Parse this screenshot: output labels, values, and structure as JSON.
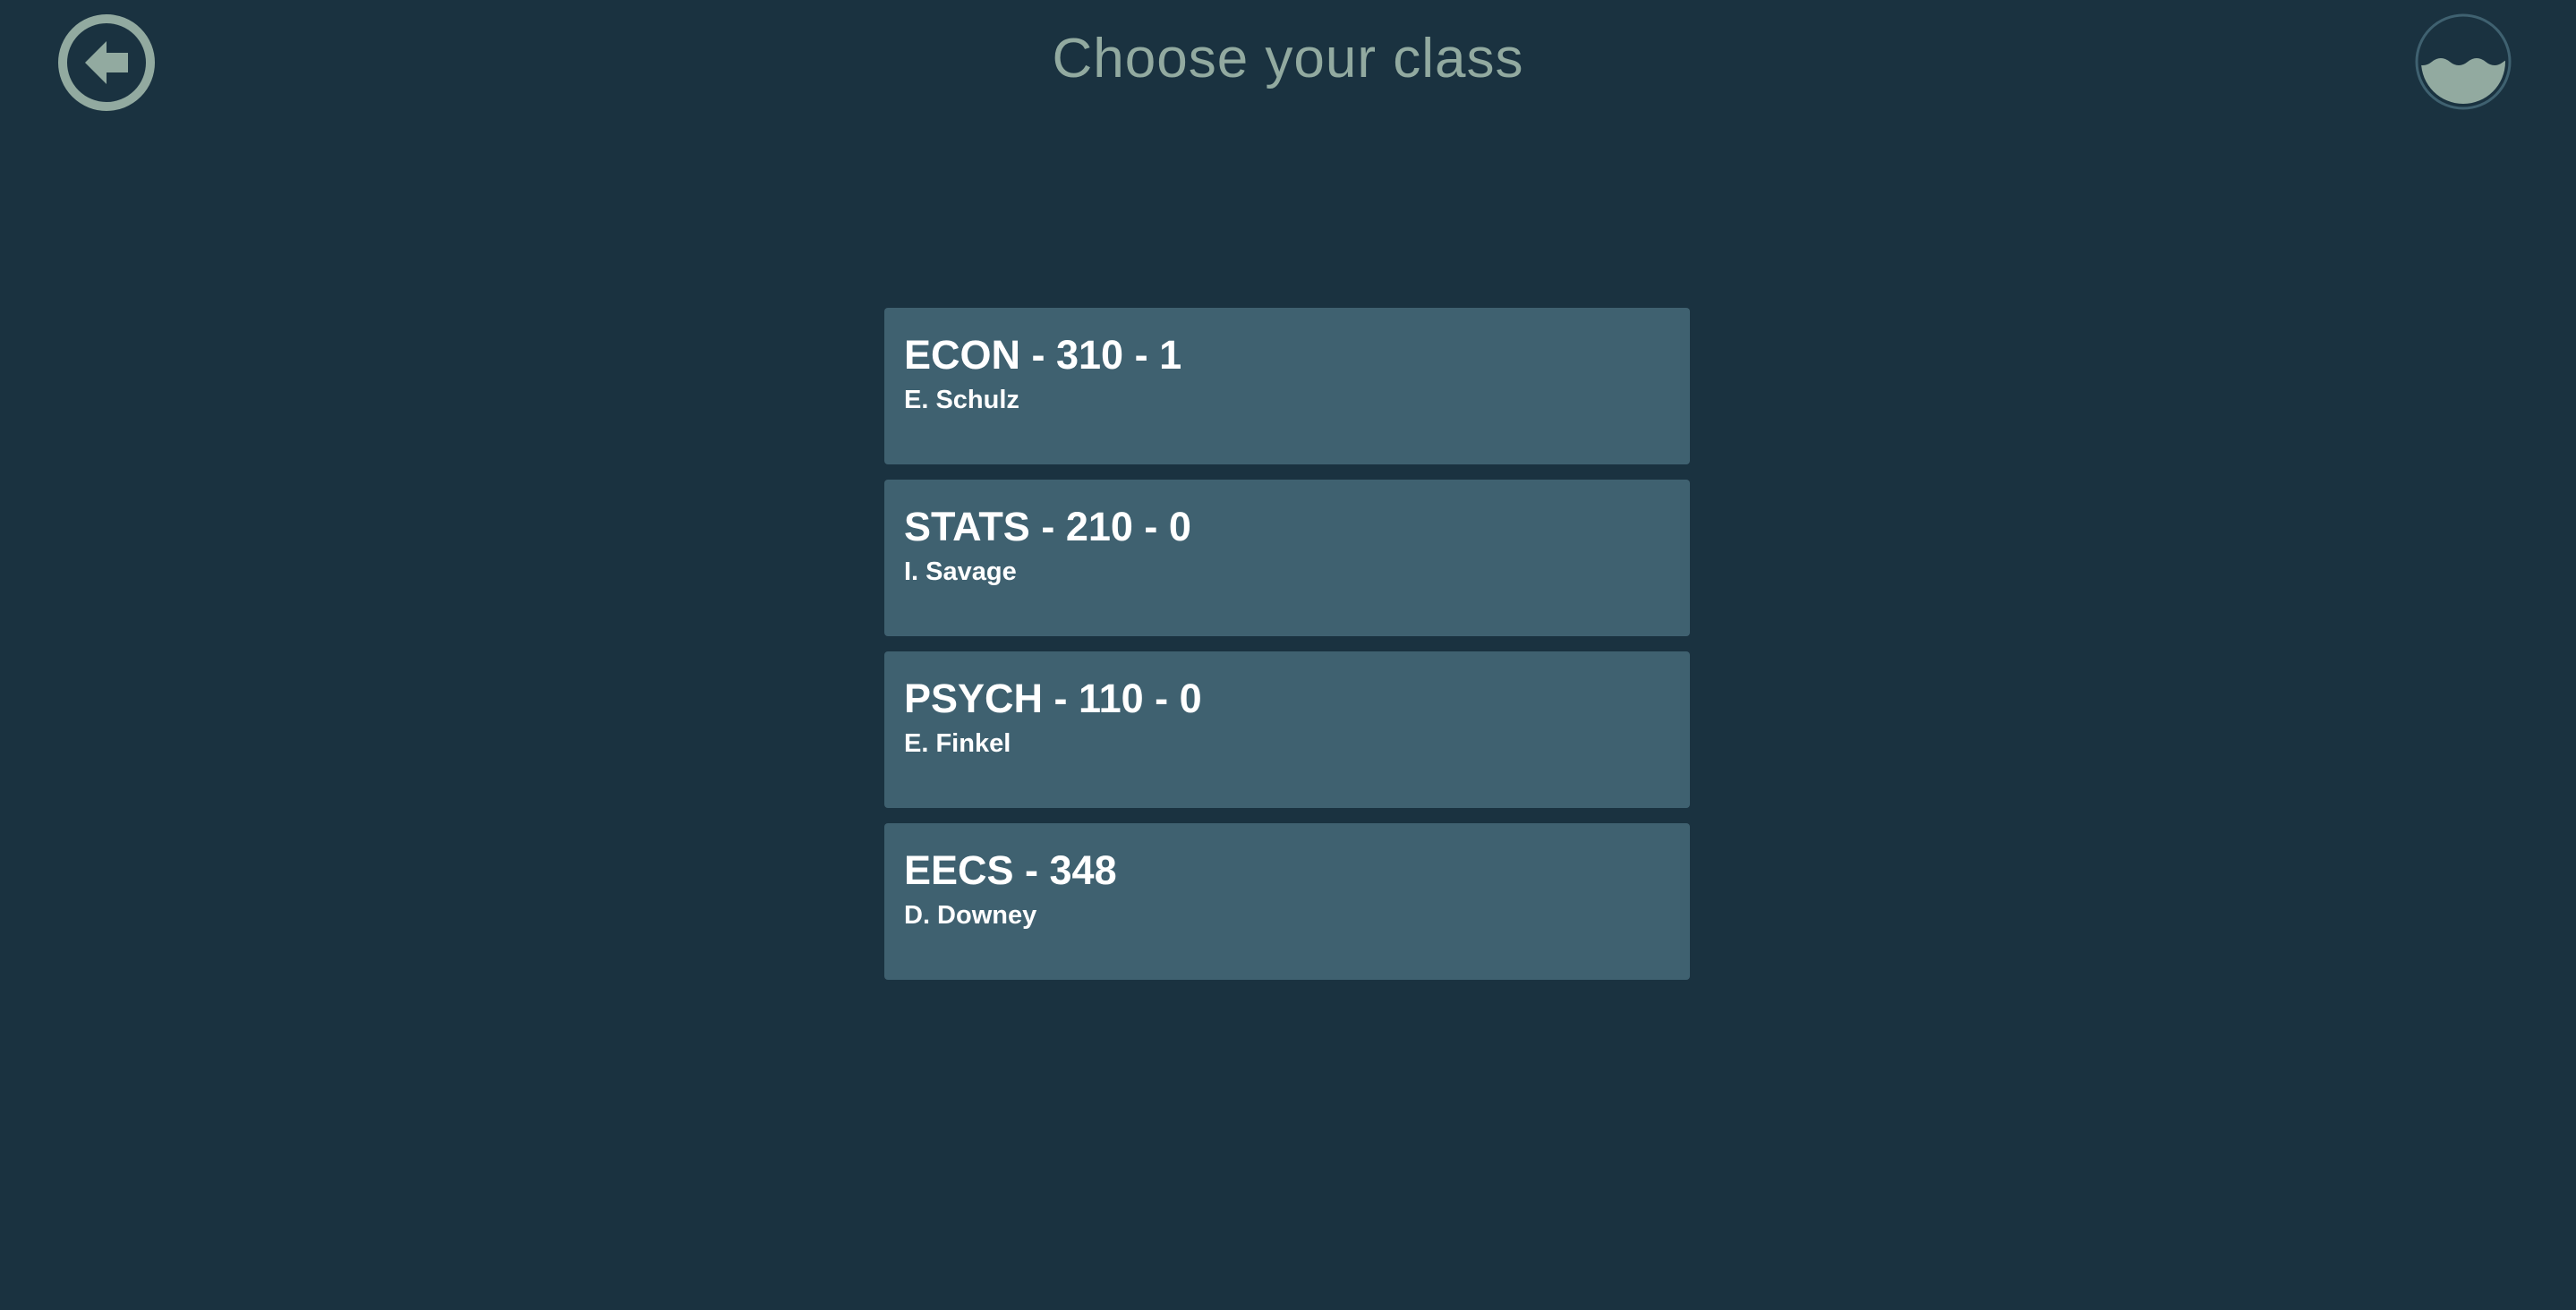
{
  "header": {
    "title": "Choose your class",
    "back_icon": "arrow-left-circle-icon",
    "logo_icon": "wave-logo-icon"
  },
  "classes": [
    {
      "name": "ECON - 310 - 1",
      "teacher": "E. Schulz"
    },
    {
      "name": "STATS - 210 - 0",
      "teacher": "I. Savage"
    },
    {
      "name": "PSYCH - 110 - 0",
      "teacher": "E. Finkel"
    },
    {
      "name": "EECS - 348",
      "teacher": "D. Downey"
    }
  ],
  "colors": {
    "background": "#1a3240",
    "card": "#3f6170",
    "title": "#92aaa0",
    "icon": "#92aaa0",
    "logo_ring": "#3f6170",
    "text": "#ffffff"
  }
}
